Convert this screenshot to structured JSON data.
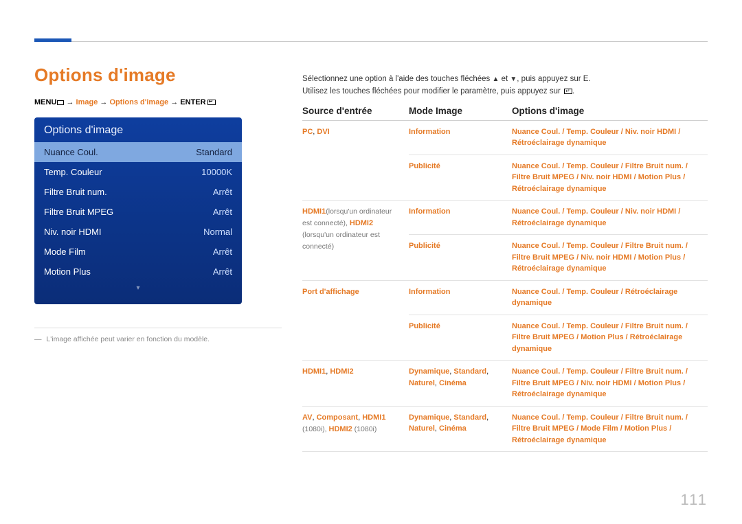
{
  "page_number": "111",
  "title": "Options d'image",
  "breadcrumb": {
    "menu": "MENU",
    "arrow": " → ",
    "p1": "Image",
    "p2": "Options d'image",
    "enter": "ENTER"
  },
  "panel": {
    "title": "Options d'image",
    "items": [
      {
        "label": "Nuance Coul.",
        "value": "Standard",
        "sel": true
      },
      {
        "label": "Temp. Couleur",
        "value": "10000K"
      },
      {
        "label": "Filtre Bruit num.",
        "value": "Arrêt"
      },
      {
        "label": "Filtre Bruit MPEG",
        "value": "Arrêt"
      },
      {
        "label": "Niv. noir HDMI",
        "value": "Normal"
      },
      {
        "label": "Mode Film",
        "value": "Arrêt"
      },
      {
        "label": "Motion Plus",
        "value": "Arrêt"
      }
    ],
    "caret": "▾"
  },
  "note": "L'image affichée peut varier en fonction du modèle.",
  "intro": {
    "l1a": "Sélectionnez une option à l'aide des touches fléchées ",
    "l1b": " et ",
    "l1c": ", puis appuyez sur E.",
    "l2a": "Utilisez les touches fléchées pour modifier le paramètre, puis appuyez sur ",
    "l2b": "."
  },
  "headers": {
    "c1": "Source d'entrée",
    "c2": "Mode Image",
    "c3": "Options d'image"
  },
  "rows": [
    {
      "src": [
        {
          "t": "PC",
          "o": true
        },
        {
          "t": ", "
        },
        {
          "t": "DVI",
          "o": true
        }
      ],
      "sub": [
        {
          "mode": "Information",
          "opts": [
            [
              "Nuance Coul."
            ],
            [
              "Temp. Couleur"
            ],
            [
              "Niv. noir HDMI"
            ],
            [
              "Rétroéclairage dynamique"
            ]
          ]
        },
        {
          "mode": "Publicité",
          "opts": [
            [
              "Nuance Coul."
            ],
            [
              "Temp. Couleur"
            ],
            [
              "Filtre Bruit num."
            ],
            [
              "Filtre Bruit MPEG"
            ],
            [
              "Niv. noir HDMI"
            ],
            [
              "Motion Plus"
            ],
            [
              "Rétroéclairage dynamique"
            ]
          ]
        }
      ]
    },
    {
      "src": [
        {
          "t": "HDMI1",
          "o": true
        },
        {
          "t": "(lorsqu'un ordinateur est connecté), ",
          "g": true
        },
        {
          "t": "HDMI2",
          "o": true
        },
        {
          "t": " (lorsqu'un ordinateur est connecté)",
          "g": true
        }
      ],
      "sub": [
        {
          "mode": "Information",
          "opts": [
            [
              "Nuance Coul."
            ],
            [
              "Temp. Couleur"
            ],
            [
              "Niv. noir HDMI"
            ],
            [
              "Rétroéclairage dynamique"
            ]
          ]
        },
        {
          "mode": "Publicité",
          "opts": [
            [
              "Nuance Coul."
            ],
            [
              "Temp. Couleur"
            ],
            [
              "Filtre Bruit num."
            ],
            [
              "Filtre Bruit MPEG"
            ],
            [
              "Niv. noir HDMI"
            ],
            [
              "Motion Plus"
            ],
            [
              "Rétroéclairage dynamique"
            ]
          ]
        }
      ]
    },
    {
      "src": [
        {
          "t": "Port d'affichage",
          "o": true
        }
      ],
      "sub": [
        {
          "mode": "Information",
          "opts": [
            [
              "Nuance Coul."
            ],
            [
              "Temp. Couleur"
            ],
            [
              "Rétroéclairage dynamique"
            ]
          ]
        },
        {
          "mode": "Publicité",
          "opts": [
            [
              "Nuance Coul."
            ],
            [
              "Temp. Couleur"
            ],
            [
              "Filtre Bruit num."
            ],
            [
              "Filtre Bruit MPEG"
            ],
            [
              "Motion Plus"
            ],
            [
              "Rétroéclairage dynamique"
            ]
          ]
        }
      ]
    },
    {
      "src": [
        {
          "t": "HDMI1",
          "o": true
        },
        {
          "t": ", "
        },
        {
          "t": "HDMI2",
          "o": true
        }
      ],
      "sub": [
        {
          "mode_list": [
            "Dynamique",
            "Standard",
            "Naturel",
            "Cinéma"
          ],
          "opts": [
            [
              "Nuance Coul."
            ],
            [
              "Temp. Couleur"
            ],
            [
              "Filtre Bruit num."
            ],
            [
              "Filtre Bruit MPEG"
            ],
            [
              "Niv. noir HDMI"
            ],
            [
              "Motion Plus"
            ],
            [
              "Rétroéclairage dynamique"
            ]
          ]
        }
      ]
    },
    {
      "src": [
        {
          "t": "AV",
          "o": true
        },
        {
          "t": ", "
        },
        {
          "t": "Composant",
          "o": true
        },
        {
          "t": ", "
        },
        {
          "t": "HDMI1",
          "o": true
        },
        {
          "t": " (1080i), ",
          "g": true
        },
        {
          "t": "HDMI2",
          "o": true
        },
        {
          "t": " (1080i)",
          "g": true
        }
      ],
      "sub": [
        {
          "mode_list": [
            "Dynamique",
            "Standard",
            "Naturel",
            "Cinéma"
          ],
          "opts": [
            [
              "Nuance Coul."
            ],
            [
              "Temp. Couleur"
            ],
            [
              "Filtre Bruit num."
            ],
            [
              "Filtre Bruit MPEG"
            ],
            [
              "Mode Film"
            ],
            [
              "Motion Plus"
            ],
            [
              "Rétroéclairage dynamique"
            ]
          ]
        }
      ]
    }
  ]
}
